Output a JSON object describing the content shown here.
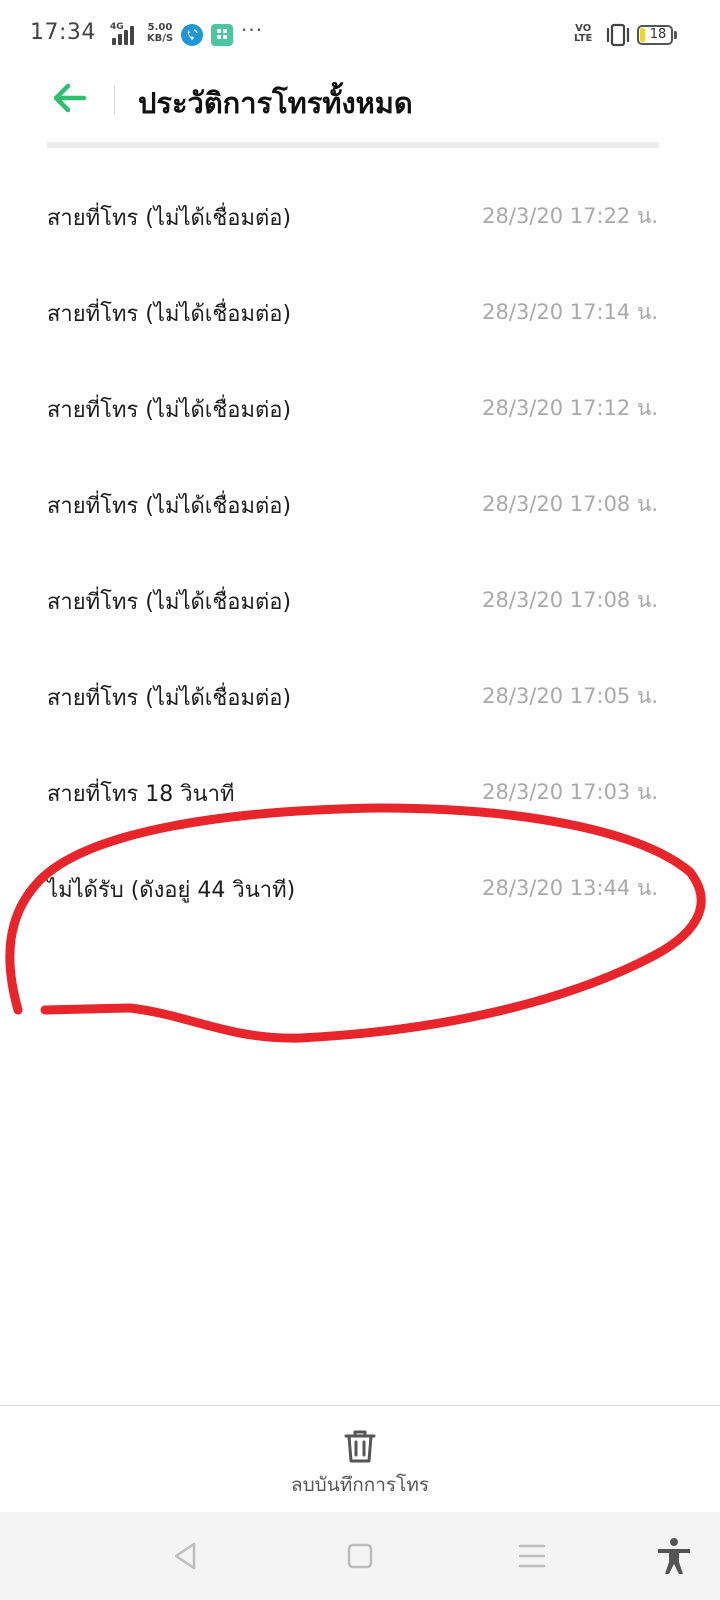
{
  "status_bar": {
    "time": "17:34",
    "network_type": "4G",
    "speed_value": "5.00",
    "speed_unit": "KB/S",
    "more": "···",
    "volte_top": "VO",
    "volte_bottom": "LTE",
    "battery_level": "18",
    "battery_color": "#f2d22e"
  },
  "header": {
    "title": "ประวัติการโทรทั้งหมด",
    "back_icon": "arrow-left-icon",
    "accent_color": "#2fbf71"
  },
  "calls": [
    {
      "description": "สายที่โทร (ไม่ได้เชื่อมต่อ)",
      "time": "28/3/20 17:22 น."
    },
    {
      "description": "สายที่โทร (ไม่ได้เชื่อมต่อ)",
      "time": "28/3/20 17:14 น."
    },
    {
      "description": "สายที่โทร (ไม่ได้เชื่อมต่อ)",
      "time": "28/3/20 17:12 น."
    },
    {
      "description": "สายที่โทร (ไม่ได้เชื่อมต่อ)",
      "time": "28/3/20 17:08 น."
    },
    {
      "description": "สายที่โทร (ไม่ได้เชื่อมต่อ)",
      "time": "28/3/20 17:08 น."
    },
    {
      "description": "สายที่โทร (ไม่ได้เชื่อมต่อ)",
      "time": "28/3/20 17:05 น."
    },
    {
      "description": "สายที่โทร  18 วินาที",
      "time": "28/3/20 17:03 น."
    },
    {
      "description": "ไม่ได้รับ (ดังอยู่ 44 วินาที)",
      "time": "28/3/20 13:44 น."
    }
  ],
  "annotation": {
    "color": "#e8252b",
    "shape": "hand-drawn circle around last call"
  },
  "footer": {
    "delete_label": "ลบบันทึกการโทร",
    "delete_icon": "trash-icon"
  },
  "nav_bar": {
    "icons": [
      "back-triangle-icon",
      "home-square-icon",
      "recents-menu-icon",
      "accessibility-icon"
    ]
  }
}
